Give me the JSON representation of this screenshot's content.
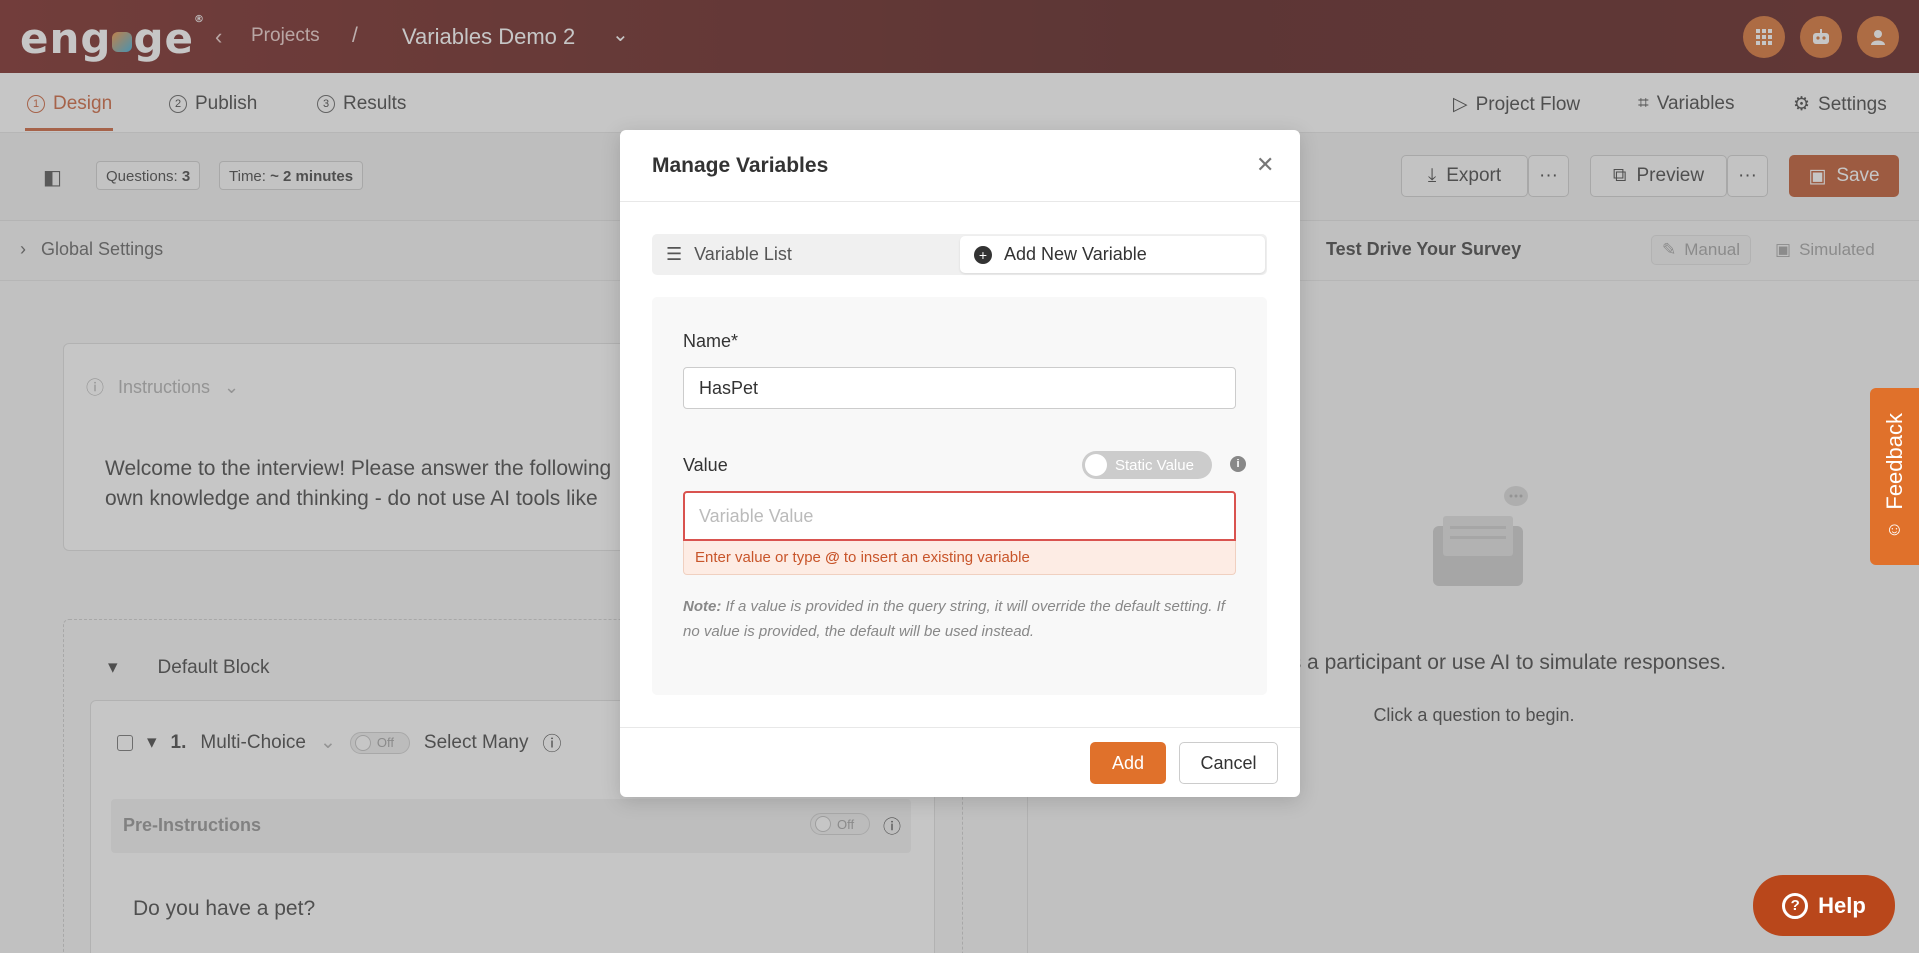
{
  "header": {
    "logo": "engage",
    "back_label": "Projects",
    "separator": "/",
    "project_title": "Variables Demo 2"
  },
  "nav": {
    "tabs": [
      {
        "num": "1",
        "label": "Design"
      },
      {
        "num": "2",
        "label": "Publish"
      },
      {
        "num": "3",
        "label": "Results"
      }
    ],
    "right": {
      "project_flow": "Project Flow",
      "variables": "Variables",
      "settings": "Settings"
    }
  },
  "toolbar": {
    "questions_label": "Questions:",
    "questions_count": "3",
    "time_label": "Time:",
    "time_value": "~ 2 minutes",
    "export": "Export",
    "preview": "Preview",
    "save": "Save",
    "more": "···"
  },
  "global_settings": {
    "label": "Global Settings",
    "test_drive": "Test Drive Your Survey",
    "mode_manual": "Manual",
    "mode_simulated": "Simulated"
  },
  "instructions": {
    "header": "Instructions",
    "text_line1": "Welcome to the interview! Please answer the following",
    "text_line2": "own knowledge and thinking - do not use AI tools like"
  },
  "block": {
    "title": "Default Block",
    "question": {
      "number": "1.",
      "type": "Multi-Choice",
      "toggle": "Off",
      "select_many": "Select Many",
      "pre_instructions": "Pre-Instructions",
      "pre_toggle": "Off",
      "text": "Do you have a pet?"
    }
  },
  "right_pane": {
    "text1": "urvey as a participant or use AI to simulate responses.",
    "text2": "Click a question to begin."
  },
  "feedback": "Feedback",
  "help": "Help",
  "modal": {
    "title": "Manage Variables",
    "seg_list": "Variable List",
    "seg_add": "Add New Variable",
    "name_label": "Name*",
    "name_value": "HasPet",
    "value_label": "Value",
    "static_toggle": "Static Value",
    "value_placeholder": "Variable Value",
    "error_pre": "Enter value or type ",
    "error_at": "@",
    "error_post": " to insert an existing variable",
    "note_label": "Note:",
    "note_text": " If a value is provided in the query string, it will override the default setting. If no value is provided, the default will be used instead.",
    "add": "Add",
    "cancel": "Cancel"
  },
  "colors": {
    "brand_dark": "#4a0806",
    "accent": "#e0712b",
    "save": "#b9471b",
    "error": "#d9534f"
  }
}
